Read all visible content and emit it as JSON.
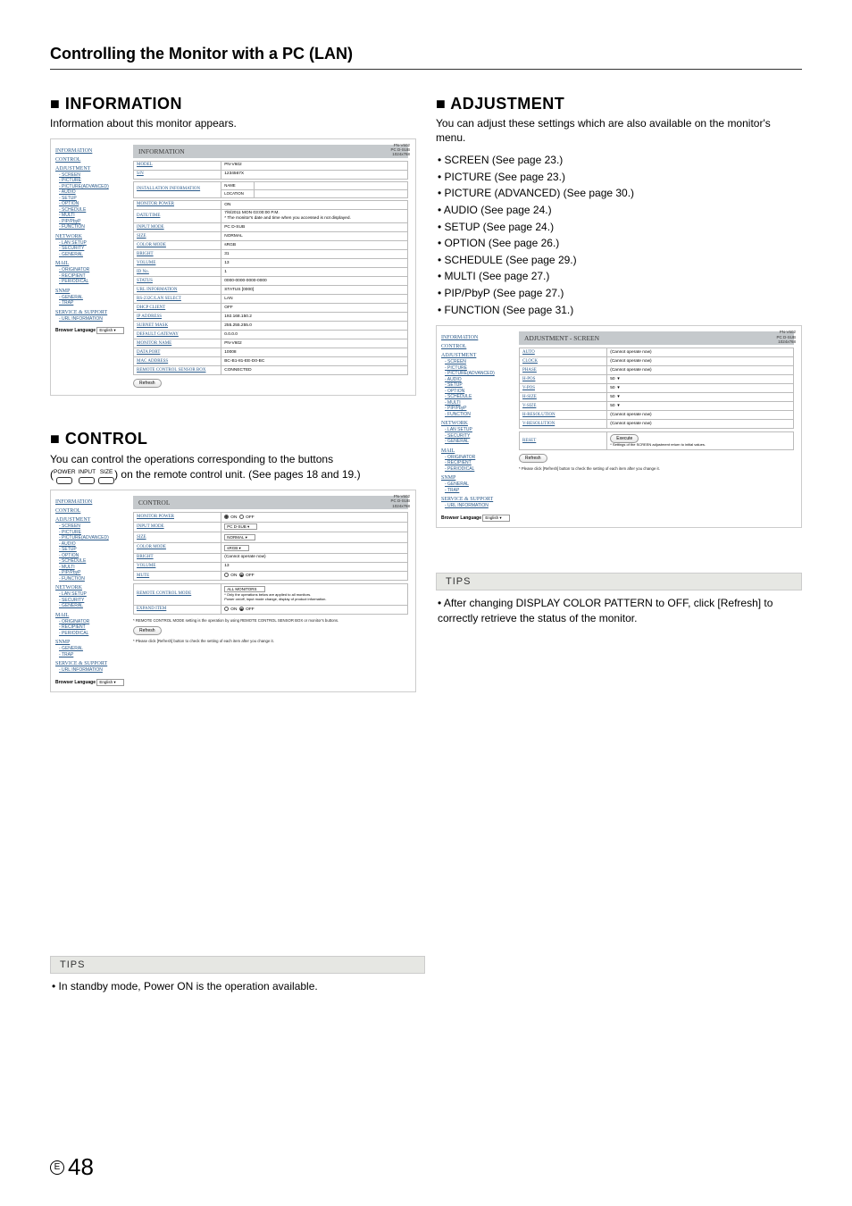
{
  "page_title": "Controlling the Monitor with a PC (LAN)",
  "page_number_letter": "E",
  "page_number": "48",
  "sections": {
    "information": {
      "heading": "■ INFORMATION",
      "sub": "Information about this monitor appears."
    },
    "control": {
      "heading": "■ CONTROL",
      "line1": "You can control the operations corresponding to the buttons",
      "line2_tail": ") on the remote control unit. (See pages 18 and 19.)",
      "rb_labels": {
        "power": "POWER",
        "input": "INPUT",
        "size": "SIZE"
      }
    },
    "adjustment": {
      "heading": "■ ADJUSTMENT",
      "sub": "You can adjust these settings which are also available on the monitor's menu.",
      "bullets": [
        "SCREEN (See page 23.)",
        "PICTURE (See page 23.)",
        "PICTURE (ADVANCED) (See page 30.)",
        "AUDIO (See page 24.)",
        "SETUP (See page 24.)",
        "OPTION (See page 26.)",
        "SCHEDULE (See page 29.)",
        "MULTI (See page 27.)",
        "PIP/PbyP (See page 27.)",
        "FUNCTION (See page 31.)"
      ]
    }
  },
  "tips_left": {
    "head": "TIPS",
    "body": "In standby mode, Power ON is the operation available."
  },
  "tips_right": {
    "head": "TIPS",
    "body": "After changing DISPLAY COLOR PATTERN to OFF, click [Refresh] to correctly retrieve the status of the monitor."
  },
  "sidebar": {
    "information": "INFORMATION",
    "control": "CONTROL",
    "adjustment": "ADJUSTMENT",
    "adj_items": [
      "SCREEN",
      "PICTURE",
      "PICTURE(ADVANCED)",
      "AUDIO",
      "SETUP",
      "OPTION",
      "SCHEDULE",
      "MULTI",
      "PIP/PbyP",
      "FUNCTION"
    ],
    "network": "NETWORK",
    "net_items": [
      "LAN SETUP",
      "SECURITY",
      "GENERAL"
    ],
    "mail": "MAIL",
    "mail_items": [
      "ORIGINATOR",
      "RECIPIENT",
      "PERIODICAL"
    ],
    "snmp": "SNMP",
    "snmp_items": [
      "GENERAL",
      "TRAP"
    ],
    "service": "SERVICE & SUPPORT",
    "svc_items": [
      "URL INFORMATION"
    ],
    "browser_lang_label": "Browser Language",
    "browser_lang_value": "English"
  },
  "topright": {
    "l1": "PN-V602",
    "l2": "PC D-SUB",
    "l3": "1024x768"
  },
  "panels": {
    "information": {
      "title": "INFORMATION",
      "rows": [
        {
          "h": "MODEL",
          "v": "PN-V602"
        },
        {
          "h": "S/N",
          "v": "1234567X"
        }
      ],
      "install": "INSTALLATION INFORMATION",
      "install_rows": [
        {
          "h": "NAME",
          "v": ""
        },
        {
          "h": "LOCATION",
          "v": ""
        }
      ],
      "rows2": [
        {
          "h": "MONITOR POWER",
          "v": "ON"
        },
        {
          "h": "DATE/TIME",
          "v": "7/6/2011 MON 03:00:00 P.M.\n* The monitor's date and time when you accessed is not displayed."
        },
        {
          "h": "INPUT MODE",
          "v": "PC D-SUB"
        },
        {
          "h": "SIZE",
          "v": "NORMAL"
        },
        {
          "h": "COLOR MODE",
          "v": "sRGB"
        },
        {
          "h": "BRIGHT",
          "v": "31"
        },
        {
          "h": "VOLUME",
          "v": "13"
        },
        {
          "h": "ID No.",
          "v": "1"
        },
        {
          "h": "STATUS",
          "v": "0000-0000-0000-0000"
        },
        {
          "h": "URL INFORMATION",
          "v": "STATUS [0000]"
        },
        {
          "h": "RS-232C/LAN SELECT",
          "v": "LAN"
        },
        {
          "h": "DHCP CLIENT",
          "v": "OFF"
        },
        {
          "h": "IP ADDRESS",
          "v": "192.168.150.2"
        },
        {
          "h": "SUBNET MASK",
          "v": "255.255.255.0"
        },
        {
          "h": "DEFAULT GATEWAY",
          "v": "0.0.0.0"
        },
        {
          "h": "MONITOR NAME",
          "v": "PN-V602"
        },
        {
          "h": "DATA PORT",
          "v": "10008"
        },
        {
          "h": "MAC ADDRESS",
          "v": "BC-B1-81-EE-D0-BC"
        },
        {
          "h": "REMOTE CONTROL SENSOR BOX",
          "v": "CONNECTED"
        }
      ],
      "refresh": "Refresh"
    },
    "control": {
      "title": "CONTROL",
      "rows": [
        {
          "h": "MONITOR POWER",
          "type": "radio",
          "on": "ON",
          "off": "OFF",
          "val": "ON"
        },
        {
          "h": "INPUT MODE",
          "type": "select",
          "val": "PC D-SUB"
        },
        {
          "h": "SIZE",
          "type": "select",
          "val": "NORMAL"
        },
        {
          "h": "COLOR MODE",
          "type": "select",
          "val": "sRGB"
        },
        {
          "h": "BRIGHT",
          "type": "text",
          "val": "(Cannot operate now)"
        },
        {
          "h": "VOLUME",
          "type": "text",
          "val": "13"
        },
        {
          "h": "MUTE",
          "type": "radio",
          "on": "ON",
          "off": "OFF",
          "val": "OFF"
        }
      ],
      "remote_mode": "REMOTE CONTROL MODE",
      "remote_sel": "ALL MONITORS",
      "remote_note": "* Only the operations below are applied to all monitors.\n Power on/off, input mode change, display of product information.",
      "expand": "EXPAND ITEM",
      "expand_on": "ON",
      "expand_off": "OFF",
      "expand_val": "OFF",
      "rc_note": "* REMOTE CONTROL MODE setting is the operation by using REMOTE CONTROL SENSOR BOX or monitor's buttons.",
      "refresh": "Refresh",
      "foot": "* Please click [Refresh] button to check the setting of each item after you change it."
    },
    "adjustment": {
      "title": "ADJUSTMENT - SCREEN",
      "rows": [
        {
          "h": "AUTO",
          "v": "(Cannot operate now)"
        },
        {
          "h": "CLOCK",
          "v": "(Cannot operate now)"
        },
        {
          "h": "PHASE",
          "v": "(Cannot operate now)"
        },
        {
          "h": "H-POS",
          "v": "50"
        },
        {
          "h": "V-POS",
          "v": "50"
        },
        {
          "h": "H-SIZE",
          "v": "50"
        },
        {
          "h": "V-SIZE",
          "v": "50"
        },
        {
          "h": "H-RESOLUTION",
          "v": "(Cannot operate now)"
        },
        {
          "h": "V-RESOLUTION",
          "v": "(Cannot operate now)"
        }
      ],
      "reset": "RESET",
      "reset_btn": "Execute",
      "reset_note": "* Settings of the SCREEN adjustment return to initial values.",
      "refresh": "Refresh",
      "foot": "* Please click [Refresh] button to check the setting of each item after you change it."
    }
  }
}
